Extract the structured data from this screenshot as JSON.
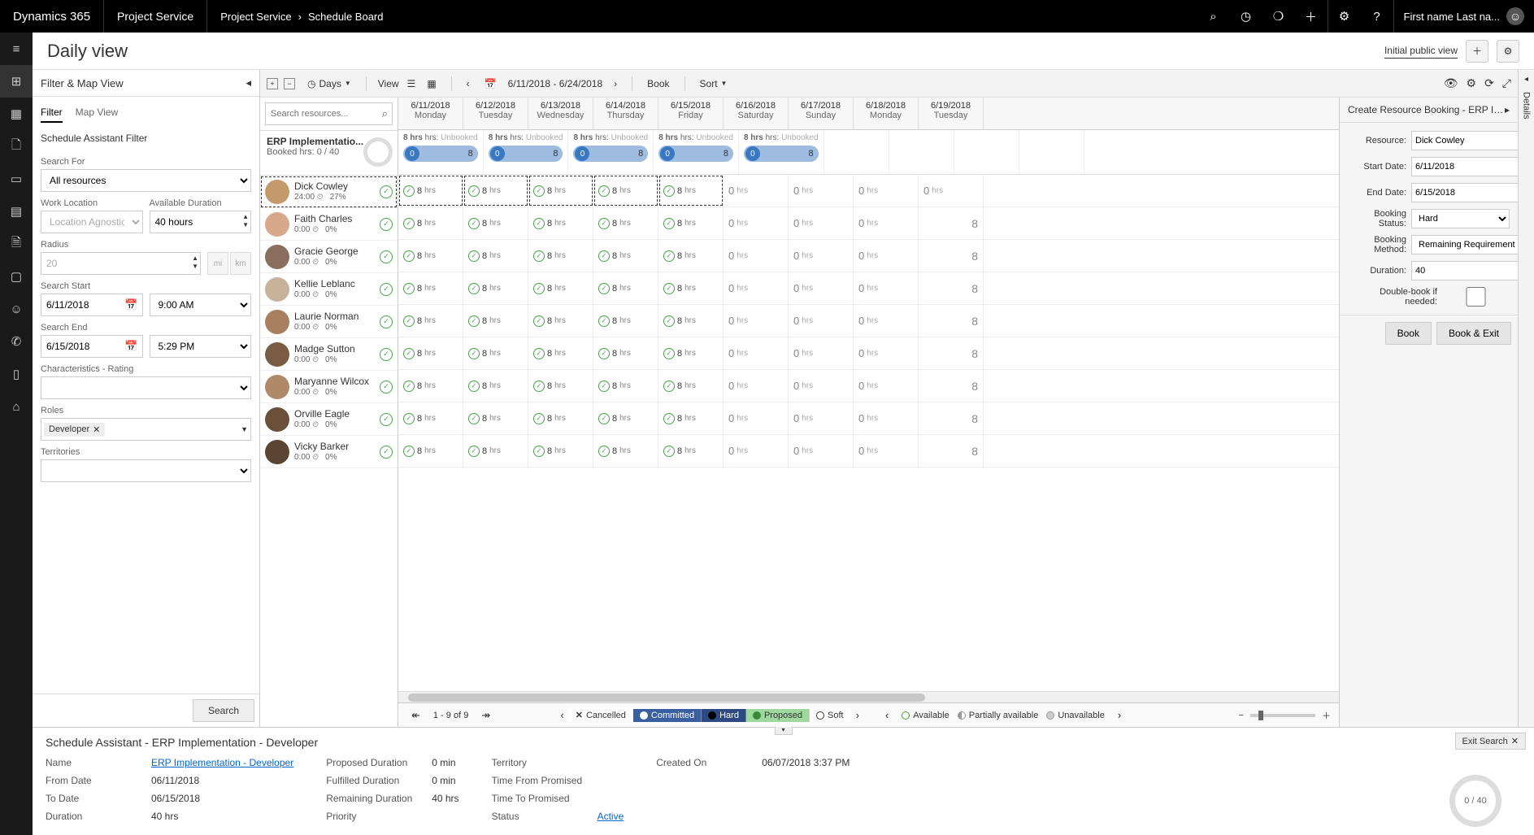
{
  "topbar": {
    "brand": "Dynamics 365",
    "module": "Project Service",
    "crumb1": "Project Service",
    "crumb2": "Schedule Board",
    "user": "First name Last na..."
  },
  "page": {
    "title": "Daily view",
    "view_name": "Initial public view"
  },
  "filter": {
    "header": "Filter & Map View",
    "tab_filter": "Filter",
    "tab_map": "Map View",
    "section": "Schedule Assistant Filter",
    "search_for_label": "Search For",
    "search_for_value": "All resources",
    "work_location_label": "Work Location",
    "work_location_value": "Location Agnostic",
    "avail_duration_label": "Available Duration",
    "avail_duration_value": "40 hours",
    "radius_label": "Radius",
    "radius_value": "20",
    "unit_mi": "mi",
    "unit_km": "km",
    "search_start_label": "Search Start",
    "search_start_date": "6/11/2018",
    "search_start_time": "9:00 AM",
    "search_end_label": "Search End",
    "search_end_date": "6/15/2018",
    "search_end_time": "5:29 PM",
    "char_label": "Characteristics - Rating",
    "roles_label": "Roles",
    "roles_chip": "Developer",
    "territories_label": "Territories",
    "search_btn": "Search"
  },
  "toolbar": {
    "days": "Days",
    "view": "View",
    "range": "6/11/2018 - 6/24/2018",
    "book": "Book",
    "sort": "Sort"
  },
  "resource_search_placeholder": "Search resources...",
  "erp": {
    "title": "ERP Implementatio...",
    "sub": "Booked hrs: 0 / 40",
    "cell_top_prefix": "8 hrs:",
    "cell_top_suffix": "Unbooked",
    "pill_left": "0",
    "pill_right": "8"
  },
  "days": [
    {
      "date": "6/11/2018",
      "dow": "Monday",
      "kind": "avail"
    },
    {
      "date": "6/12/2018",
      "dow": "Tuesday",
      "kind": "avail"
    },
    {
      "date": "6/13/2018",
      "dow": "Wednesday",
      "kind": "avail"
    },
    {
      "date": "6/14/2018",
      "dow": "Thursday",
      "kind": "avail"
    },
    {
      "date": "6/15/2018",
      "dow": "Friday",
      "kind": "avail"
    },
    {
      "date": "6/16/2018",
      "dow": "Saturday",
      "kind": "zero"
    },
    {
      "date": "6/17/2018",
      "dow": "Sunday",
      "kind": "zero"
    },
    {
      "date": "6/18/2018",
      "dow": "Monday",
      "kind": "zero"
    },
    {
      "date": "6/19/2018",
      "dow": "Tuesday",
      "kind": "zero"
    }
  ],
  "resources": [
    {
      "name": "Dick Cowley",
      "hours": "24:00",
      "pct": "27%",
      "selected": true
    },
    {
      "name": "Faith Charles",
      "hours": "0:00",
      "pct": "0%"
    },
    {
      "name": "Gracie George",
      "hours": "0:00",
      "pct": "0%"
    },
    {
      "name": "Kellie Leblanc",
      "hours": "0:00",
      "pct": "0%"
    },
    {
      "name": "Laurie Norman",
      "hours": "0:00",
      "pct": "0%"
    },
    {
      "name": "Madge Sutton",
      "hours": "0:00",
      "pct": "0%"
    },
    {
      "name": "Maryanne Wilcox",
      "hours": "0:00",
      "pct": "0%"
    },
    {
      "name": "Orville Eagle",
      "hours": "0:00",
      "pct": "0%"
    },
    {
      "name": "Vicky Barker",
      "hours": "0:00",
      "pct": "0%"
    }
  ],
  "avail_hours": "8",
  "avail_unit": "hrs",
  "zero_hours": "0",
  "bignum": "8",
  "booking": {
    "header": "Create Resource Booking - ERP Impler",
    "resource_label": "Resource:",
    "resource_value": "Dick Cowley",
    "start_label": "Start Date:",
    "start_value": "6/11/2018",
    "end_label": "End Date:",
    "end_value": "6/15/2018",
    "status_label": "Booking Status:",
    "status_value": "Hard",
    "method_label": "Booking Method:",
    "method_value": "Remaining Requirement",
    "duration_label": "Duration:",
    "duration_value": "40",
    "dbl_label": "Double-book if needed:",
    "btn_book": "Book",
    "btn_book_exit": "Book & Exit"
  },
  "right_rail": "Details",
  "pagination": "1 - 9 of 9",
  "legend": {
    "cancelled": "Cancelled",
    "committed": "Committed",
    "hard": "Hard",
    "proposed": "Proposed",
    "soft": "Soft",
    "available": "Available",
    "partial": "Partially available",
    "unavailable": "Unavailable"
  },
  "details": {
    "title": "Schedule Assistant - ERP Implementation - Developer",
    "name_lbl": "Name",
    "name_val": "ERP Implementation - Developer",
    "from_lbl": "From Date",
    "from_val": "06/11/2018",
    "to_lbl": "To Date",
    "to_val": "06/15/2018",
    "dur_lbl": "Duration",
    "dur_val": "40 hrs",
    "prop_lbl": "Proposed Duration",
    "prop_val": "0 min",
    "ful_lbl": "Fulfilled Duration",
    "ful_val": "0 min",
    "rem_lbl": "Remaining Duration",
    "rem_val": "40 hrs",
    "pri_lbl": "Priority",
    "pri_val": "",
    "terr_lbl": "Territory",
    "terr_val": "",
    "tfrom_lbl": "Time From Promised",
    "tfrom_val": "",
    "tto_lbl": "Time To Promised",
    "tto_val": "",
    "stat_lbl": "Status",
    "stat_val": "Active",
    "created_lbl": "Created On",
    "created_val": "06/07/2018 3:37 PM",
    "exit": "Exit Search",
    "donut": "0 / 40"
  },
  "avatar_colors": [
    "#c49a6c",
    "#d9a88a",
    "#8a6d5a",
    "#c9b29b",
    "#a87f5f",
    "#7a5c44",
    "#b08968",
    "#6b4f3a",
    "#5c4433"
  ]
}
